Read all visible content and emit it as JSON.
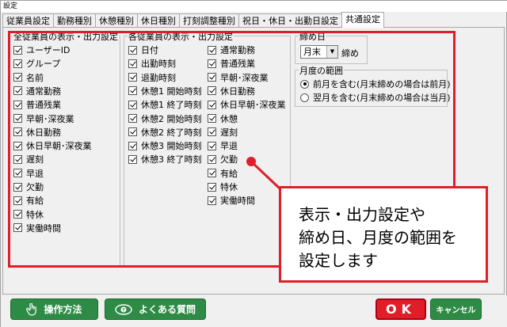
{
  "window": {
    "title": "設定"
  },
  "tabs": [
    {
      "label": "従業員設定"
    },
    {
      "label": "勤務種別"
    },
    {
      "label": "休憩種別"
    },
    {
      "label": "休日種別"
    },
    {
      "label": "打刻調整種別"
    },
    {
      "label": "祝日・休日・出勤日設定"
    },
    {
      "label": "共通設定"
    }
  ],
  "group_all": {
    "title": "全従業員の表示・出力設定",
    "items": [
      {
        "label": "ユーザーID",
        "checked": true
      },
      {
        "label": "グループ",
        "checked": true
      },
      {
        "label": "名前",
        "checked": true
      },
      {
        "label": "通常勤務",
        "checked": true
      },
      {
        "label": "普通残業",
        "checked": true
      },
      {
        "label": "早朝･深夜業",
        "checked": true
      },
      {
        "label": "休日勤務",
        "checked": true
      },
      {
        "label": "休日早朝･深夜業",
        "checked": true
      },
      {
        "label": "遅刻",
        "checked": true
      },
      {
        "label": "早退",
        "checked": true
      },
      {
        "label": "欠勤",
        "checked": true
      },
      {
        "label": "有給",
        "checked": true
      },
      {
        "label": "特休",
        "checked": true
      },
      {
        "label": "実働時間",
        "checked": true
      }
    ]
  },
  "group_each": {
    "title": "各従業員の表示・出力設定",
    "col1": [
      {
        "label": "日付",
        "checked": true
      },
      {
        "label": "出勤時刻",
        "checked": true
      },
      {
        "label": "退勤時刻",
        "checked": true
      },
      {
        "label": "休憩1 開始時刻",
        "checked": true
      },
      {
        "label": "休憩1 終了時刻",
        "checked": true
      },
      {
        "label": "休憩2 開始時刻",
        "checked": true
      },
      {
        "label": "休憩2 終了時刻",
        "checked": true
      },
      {
        "label": "休憩3 開始時刻",
        "checked": true
      },
      {
        "label": "休憩3 終了時刻",
        "checked": true
      }
    ],
    "col2": [
      {
        "label": "通常勤務",
        "checked": true
      },
      {
        "label": "普通残業",
        "checked": true
      },
      {
        "label": "早朝･深夜業",
        "checked": true
      },
      {
        "label": "休日勤務",
        "checked": true
      },
      {
        "label": "休日早朝･深夜業",
        "checked": true
      },
      {
        "label": "休憩",
        "checked": true
      },
      {
        "label": "遅刻",
        "checked": true
      },
      {
        "label": "早退",
        "checked": true
      },
      {
        "label": "欠勤",
        "checked": true
      },
      {
        "label": "有給",
        "checked": true
      },
      {
        "label": "特休",
        "checked": true
      },
      {
        "label": "実働時間",
        "checked": true
      }
    ]
  },
  "closing": {
    "title": "締め日",
    "selected": "月末",
    "suffix": "締め"
  },
  "month_range": {
    "title": "月度の範囲",
    "options": [
      {
        "label": "前月を含む(月末締めの場合は前月)",
        "selected": true
      },
      {
        "label": "翌月を含む(月末締めの場合は当月)",
        "selected": false
      }
    ]
  },
  "callout": {
    "lines": [
      "表示・出力設定や",
      "締め日、月度の範囲を",
      "設定します"
    ]
  },
  "footer": {
    "help_label": "操作方法",
    "faq_label": "よくある質問",
    "ok_label": "OK",
    "cancel_label": "キャンセル"
  },
  "colors": {
    "highlight": "#e01e2a",
    "button_green": "#2e8b45"
  }
}
